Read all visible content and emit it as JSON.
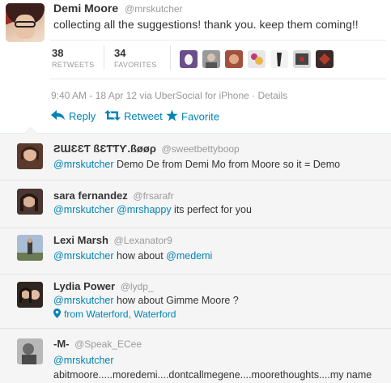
{
  "tweet": {
    "author_name": "Demi Moore",
    "author_handle": "@mrskutcher",
    "text": "collecting all the suggestions! thank you. keep them coming!!",
    "retweets_count": "38",
    "retweets_label": "RETWEETS",
    "favorites_count": "34",
    "favorites_label": "FAVORITES",
    "meta": "9:40 AM - 18 Apr 12 via UberSocial for iPhone · Details",
    "actions": {
      "reply": "Reply",
      "retweet": "Retweet",
      "favorite": "Favorite"
    },
    "favoriter_avatars": [
      "#6b4f8a",
      "#8a8a8a",
      "#a0523d",
      "#c23a7a",
      "#3a3a3a",
      "#d9d9d9",
      "#b23b2a"
    ]
  },
  "replies": [
    {
      "name": "ƧƜƐƐƬ ßƐƬƬƳ.ßøøρ",
      "handle": "@sweetbettyboop",
      "mention": "@mrskutcher",
      "text": " Demo De from Demi Mo from Moore so it = Demo",
      "avatar_color": "#5a3a2c"
    },
    {
      "name": "sara fernandez",
      "handle": "@frsarafr",
      "mention": "@mrskutcher",
      "mention2": "@mrshappy",
      "text": " its perfect for you",
      "avatar_color": "#4a3530"
    },
    {
      "name": "Lexi Marsh",
      "handle": "@Lexanator9",
      "mention": "@mrskutcher",
      "text_before": " how about ",
      "mention2": "@medemi",
      "avatar_color": "#7a8aa0"
    },
    {
      "name": "Lydia Power",
      "handle": "@lydp_",
      "mention": "@mrskutcher",
      "text": " how about Gimme Moore ?",
      "location": "from Waterford, Waterford",
      "avatar_color": "#2f2622"
    },
    {
      "name": "-M-",
      "handle": "@Speak_ECee",
      "mention": "@mrskutcher",
      "text": " abitmoore.....moredemi....dontcallmegene....moorethoughts....my name is_DEMI thinks that's all I gotz",
      "avatar_color": "#6a6a6a"
    }
  ],
  "colors": {
    "link": "#0084b4",
    "muted": "#999999",
    "text": "#333333",
    "replies_bg": "#f5f5f5"
  },
  "icons": {
    "reply": "reply-arrow-icon",
    "retweet": "retweet-icon",
    "favorite": "star-icon",
    "location": "location-pin-icon"
  }
}
